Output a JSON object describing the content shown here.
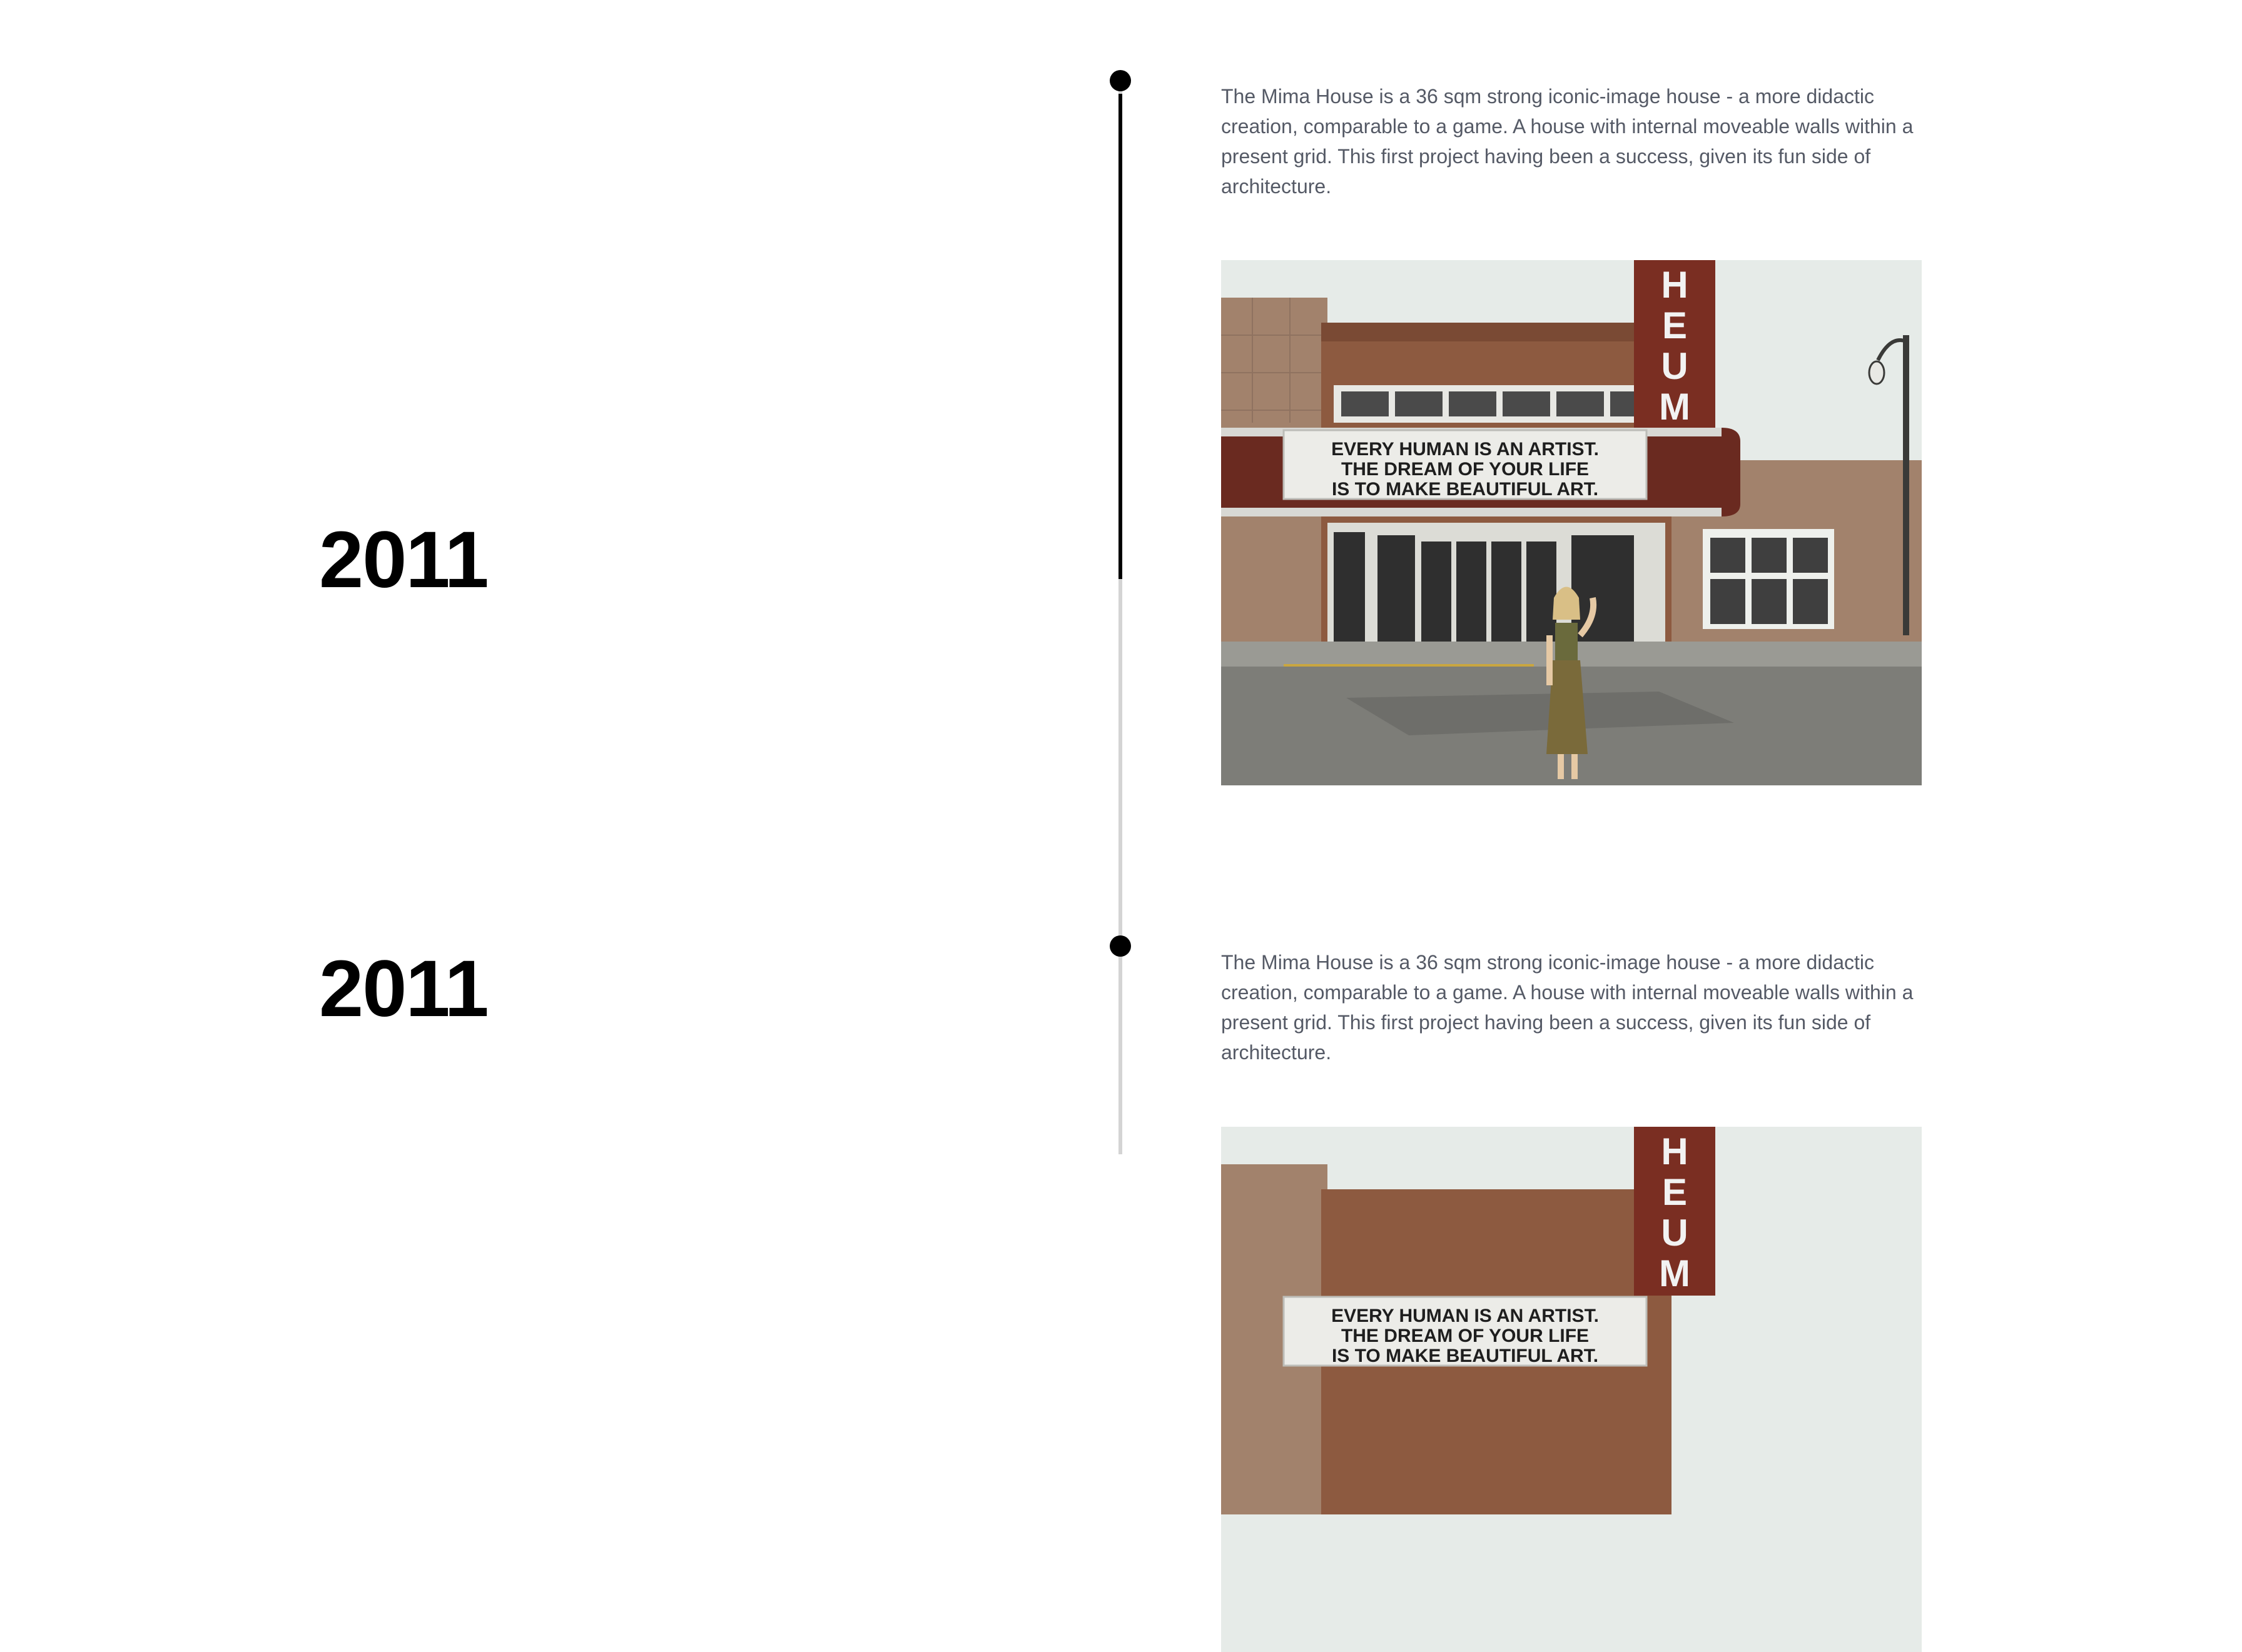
{
  "timeline": {
    "entries": [
      {
        "year": "2011",
        "description": "The Mima House is a 36 sqm strong iconic-image house - a more didactic creation, comparable to a game. A house with internal moveable walls within a present grid. This first project having been a success, given its fun side of architecture.",
        "marquee": [
          "EVERY HUMAN IS AN ARTIST.",
          "THE DREAM OF YOUR LIFE",
          "IS TO MAKE BEAUTIFUL ART."
        ],
        "sign_letters": [
          "H",
          "E",
          "U",
          "M"
        ]
      },
      {
        "year": "2011",
        "description": "The Mima House is a 36 sqm strong iconic-image house - a more didactic creation, comparable to a game. A house with internal moveable walls within a present grid. This first project having been a success, given its fun side of architecture.",
        "marquee": [
          "EVERY HUMAN IS AN ARTIST.",
          "THE DREAM OF YOUR LIFE",
          "IS TO MAKE BEAUTIFUL ART."
        ],
        "sign_letters": [
          "H",
          "E",
          "U",
          "M"
        ]
      }
    ],
    "progress_percent": 56
  },
  "colors": {
    "text_body": "#555a66",
    "year": "#000000",
    "track": "#d4d4d4",
    "progress": "#000000"
  }
}
